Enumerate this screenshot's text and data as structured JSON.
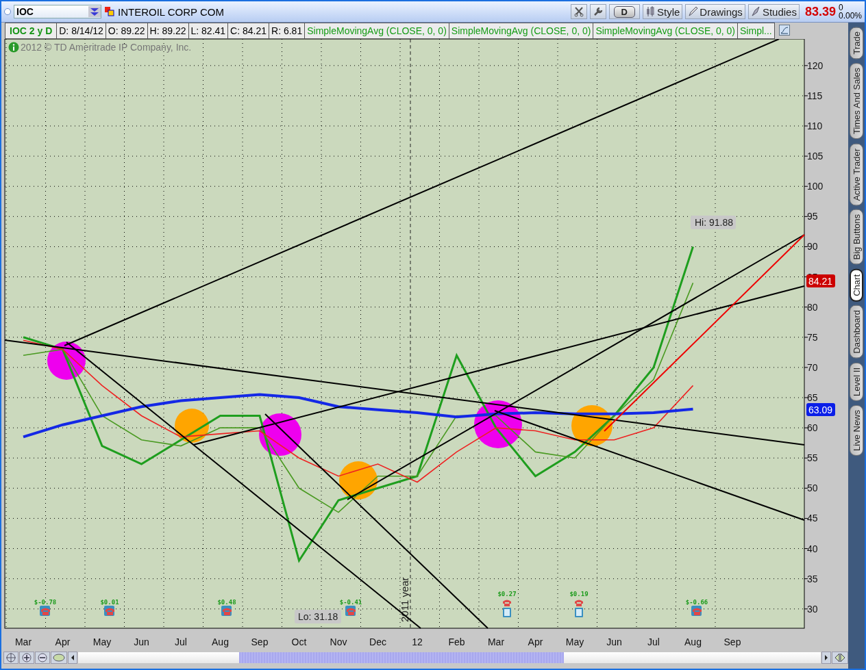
{
  "toolbar": {
    "symbol": "IOC",
    "company": "INTEROIL CORP COM",
    "buttons": [
      {
        "label": "D",
        "kind": "text"
      },
      {
        "label": "Style",
        "kind": "style"
      },
      {
        "label": "Drawings",
        "kind": "drawings"
      },
      {
        "label": "Studies",
        "kind": "studies"
      }
    ],
    "last_price": "83.39",
    "change": "0",
    "change_percent": "0.00%"
  },
  "info_bar": {
    "title": "IOC 2 y D",
    "fields": [
      "D: 8/14/12",
      "O: 89.22",
      "H: 89.22",
      "L: 82.41",
      "C: 84.21",
      "R: 6.81"
    ],
    "studies": [
      "SimpleMovingAvg (CLOSE, 0, 0)",
      "SimpleMovingAvg (CLOSE, 0, 0)",
      "SimpleMovingAvg (CLOSE, 0, 0)",
      "Simpl..."
    ]
  },
  "copyright": "2012 © TD Ameritrade IP Company, Inc.",
  "chart": {
    "chart_data": {
      "type": "line",
      "categories": [
        "Mar",
        "Apr",
        "May",
        "Jun",
        "Jul",
        "Aug",
        "Sep",
        "Oct",
        "Nov",
        "Dec",
        "12",
        "Feb",
        "Mar",
        "Apr",
        "May",
        "Jun",
        "Jul",
        "Aug",
        "Sep"
      ],
      "series": [
        {
          "color": "#1e9e1e",
          "values": [
            75,
            73,
            57,
            54,
            58,
            62,
            62,
            38,
            48,
            50,
            52,
            72,
            60,
            52,
            56,
            62,
            70,
            90,
            null
          ]
        },
        {
          "color": "#4a9a22",
          "values": [
            72,
            73,
            62,
            58,
            57,
            60,
            60,
            50,
            46,
            52,
            52,
            62,
            62,
            56,
            55,
            62,
            68,
            84,
            null
          ]
        },
        {
          "color": "#ee2222",
          "values": [
            74.5,
            73,
            67,
            62,
            58.5,
            59,
            59.5,
            55,
            52,
            54,
            51,
            56,
            60,
            59.5,
            58,
            58,
            60,
            67,
            null
          ]
        },
        {
          "color": "#1428e6",
          "values": [
            58.5,
            60.5,
            62,
            63.5,
            64.5,
            65,
            65.5,
            65,
            63.5,
            63,
            62.5,
            61.8,
            62.3,
            62.5,
            62.3,
            62.3,
            62.5,
            63.1,
            null
          ]
        }
      ],
      "grid": true,
      "ylim": [
        26.8,
        124.4
      ],
      "yticks": [
        30,
        35,
        40,
        45,
        50,
        55,
        60,
        65,
        70,
        75,
        80,
        85,
        90,
        95,
        100,
        105,
        110,
        115,
        120
      ]
    },
    "price_badges": [
      {
        "label": "84.21",
        "kind": "last"
      },
      {
        "label": "63.09",
        "kind": "study"
      }
    ],
    "hi_label": "Hi: 91.88",
    "lo_label": "Lo: 31.18",
    "year_marker": "2011 year",
    "earnings": [
      {
        "value": "$-0.78",
        "kind": "call"
      },
      {
        "value": "$0.01",
        "kind": "call"
      },
      {
        "value": "$0.48",
        "kind": "call"
      },
      {
        "value": "$-0.41",
        "kind": "call"
      },
      {
        "value": "$0.27",
        "kind": "call_dividend"
      },
      {
        "value": "$0.19",
        "kind": "call_dividend"
      },
      {
        "value": "$-0.66",
        "kind": "call"
      }
    ]
  },
  "side_tabs": [
    {
      "label": "Trade",
      "selected": false
    },
    {
      "label": "Times And Sales",
      "selected": false
    },
    {
      "label": "Active Trader",
      "selected": false
    },
    {
      "label": "Big Buttons",
      "selected": false
    },
    {
      "label": "Chart",
      "selected": true
    },
    {
      "label": "Dashboard",
      "selected": false
    },
    {
      "label": "Level II",
      "selected": false
    },
    {
      "label": "Live News",
      "selected": false
    }
  ]
}
